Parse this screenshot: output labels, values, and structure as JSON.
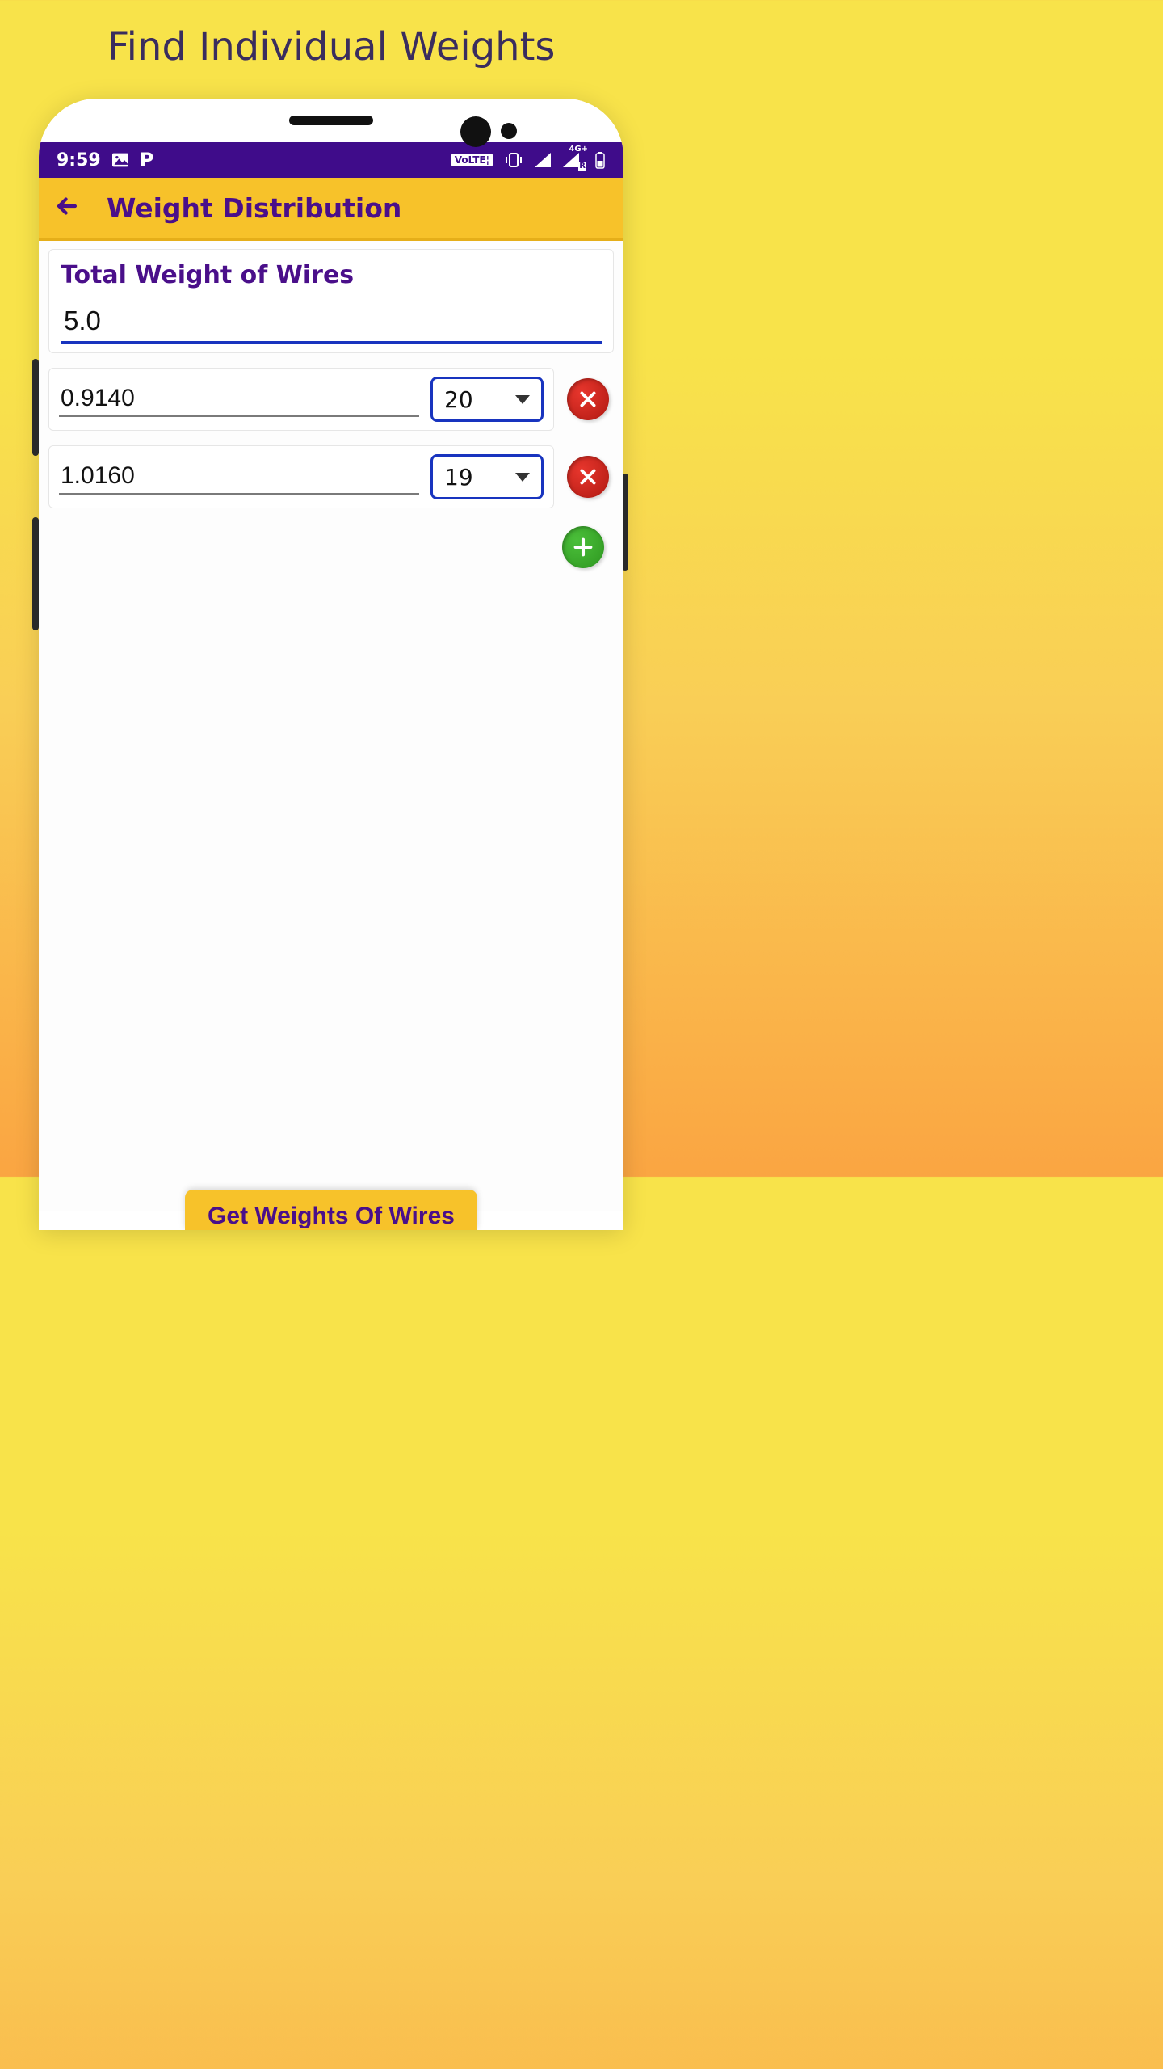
{
  "promo_title": "Find Individual Weights",
  "status_bar": {
    "time": "9:59",
    "volte_chip": "VoLTE¦",
    "net_label": "4G+",
    "roam": "R"
  },
  "app_bar": {
    "title": "Weight Distribution"
  },
  "total": {
    "label": "Total Weight of Wires",
    "value": "5.0"
  },
  "rows": [
    {
      "value": "0.9140",
      "select": "20"
    },
    {
      "value": "1.0160",
      "select": "19"
    }
  ],
  "cta_label": "Get Weights Of Wires"
}
